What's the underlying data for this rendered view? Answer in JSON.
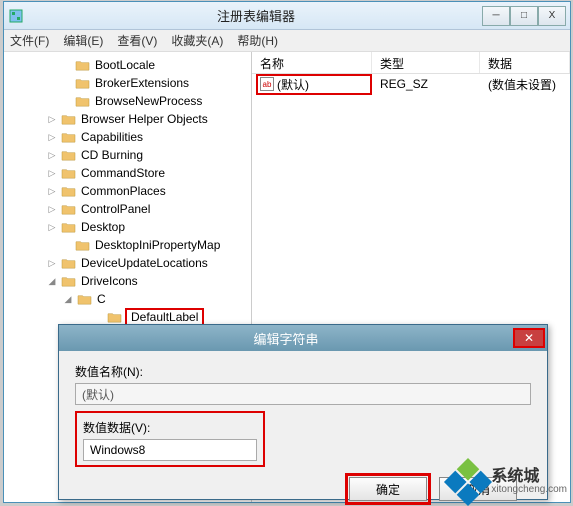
{
  "window": {
    "title": "注册表编辑器",
    "min": "─",
    "max": "□",
    "close": "X"
  },
  "menu": {
    "file": "文件(F)",
    "edit": "编辑(E)",
    "view": "查看(V)",
    "fav": "收藏夹(A)",
    "help": "帮助(H)"
  },
  "tree": [
    {
      "indent": 56,
      "chev": "",
      "label": "BootLocale"
    },
    {
      "indent": 56,
      "chev": "",
      "label": "BrokerExtensions"
    },
    {
      "indent": 56,
      "chev": "",
      "label": "BrowseNewProcess"
    },
    {
      "indent": 42,
      "chev": "▷",
      "label": "Browser Helper Objects"
    },
    {
      "indent": 42,
      "chev": "▷",
      "label": "Capabilities"
    },
    {
      "indent": 42,
      "chev": "▷",
      "label": "CD Burning"
    },
    {
      "indent": 42,
      "chev": "▷",
      "label": "CommandStore"
    },
    {
      "indent": 42,
      "chev": "▷",
      "label": "CommonPlaces"
    },
    {
      "indent": 42,
      "chev": "▷",
      "label": "ControlPanel"
    },
    {
      "indent": 42,
      "chev": "▷",
      "label": "Desktop"
    },
    {
      "indent": 56,
      "chev": "",
      "label": "DesktopIniPropertyMap"
    },
    {
      "indent": 42,
      "chev": "▷",
      "label": "DeviceUpdateLocations"
    },
    {
      "indent": 42,
      "chev": "◢",
      "label": "DriveIcons"
    },
    {
      "indent": 58,
      "chev": "◢",
      "label": "C"
    },
    {
      "indent": 88,
      "chev": "",
      "label": "DefaultLabel",
      "hl": true,
      "sel": true
    }
  ],
  "list": {
    "cols": {
      "name": "名称",
      "type": "类型",
      "data": "数据"
    },
    "row": {
      "name": "(默认)",
      "type": "REG_SZ",
      "data": "(数值未设置)"
    }
  },
  "dialog": {
    "title": "编辑字符串",
    "name_label": "数值名称(N):",
    "name_value": "(默认)",
    "data_label": "数值数据(V):",
    "data_value": "Windows8",
    "ok": "确定",
    "cancel": "取消"
  },
  "watermark": {
    "brand": "系统城",
    "url": "xitongcheng.com"
  }
}
